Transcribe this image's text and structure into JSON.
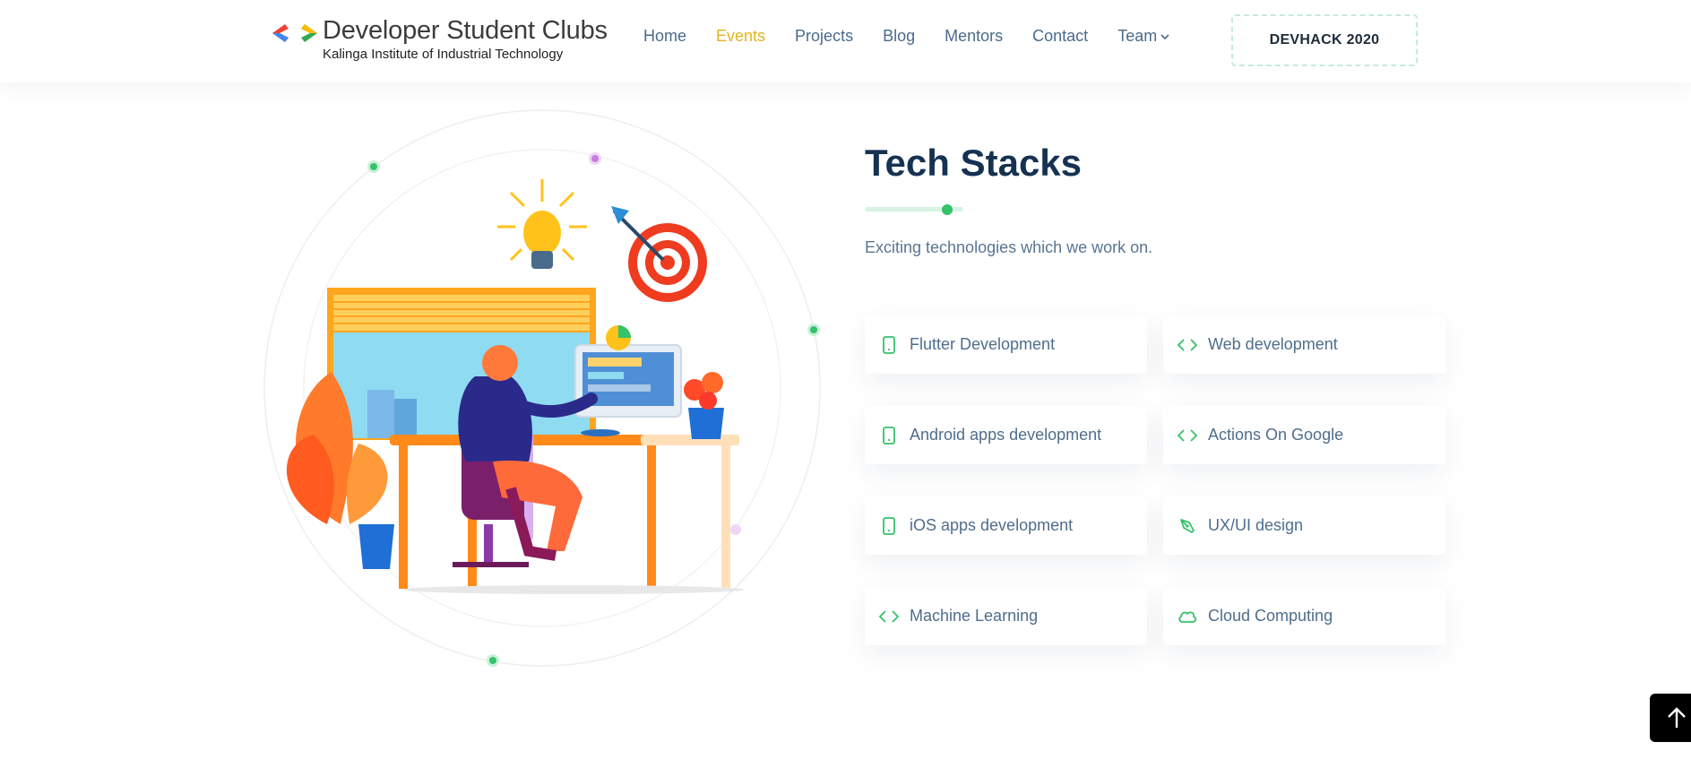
{
  "brand": {
    "title": "Developer Student Clubs",
    "subtitle": "Kalinga Institute of Industrial Technology"
  },
  "nav": {
    "items": [
      {
        "label": "Home",
        "active": false
      },
      {
        "label": "Events",
        "active": true
      },
      {
        "label": "Projects",
        "active": false
      },
      {
        "label": "Blog",
        "active": false
      },
      {
        "label": "Mentors",
        "active": false
      },
      {
        "label": "Contact",
        "active": false
      }
    ],
    "team_label": "Team",
    "cta_label": "DEVHACK 2020"
  },
  "section": {
    "title": "Tech Stacks",
    "subtitle": "Exciting technologies which we work on."
  },
  "stacks": [
    {
      "label": "Flutter Development",
      "icon": "mobile-icon"
    },
    {
      "label": "Web development",
      "icon": "code-icon"
    },
    {
      "label": "Android apps development",
      "icon": "mobile-icon"
    },
    {
      "label": "Actions On Google",
      "icon": "code-icon"
    },
    {
      "label": "iOS apps development",
      "icon": "mobile-icon"
    },
    {
      "label": "UX/UI design",
      "icon": "pen-tool-icon"
    },
    {
      "label": "Machine Learning",
      "icon": "code-icon"
    },
    {
      "label": "Cloud Computing",
      "icon": "cloud-icon"
    }
  ],
  "colors": {
    "accent_green": "#34c26a",
    "nav_active": "#e3b31c",
    "title": "#163252",
    "text": "#4f6d8c"
  }
}
